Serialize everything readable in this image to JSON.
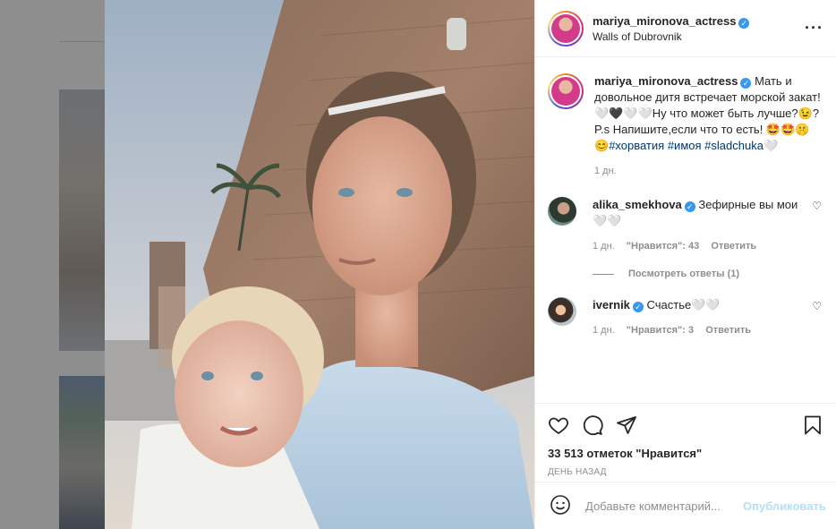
{
  "post": {
    "username": "mariya_mironova_actress",
    "location": "Walls of Dubrovnik",
    "more_icon": "more-horizontal-icon"
  },
  "caption": {
    "username": "mariya_mironova_actress",
    "text": "Мать и довольное дитя встречает морской закат! 🤍🖤🤍🤍Ну что может быть лучше?😉? P.s Напишите,если что то есть! 🤩🤩🤫😊",
    "hashtags": [
      "#хорватия",
      "#имоя",
      "#sladchuka"
    ],
    "hashtag_trail": "🤍",
    "time": "1 дн."
  },
  "comments": [
    {
      "username": "alika_smekhova",
      "text": "Зефирные вы мои🤍🤍",
      "time": "1 дн.",
      "likes_label": "\"Нравится\": 43",
      "reply_label": "Ответить"
    },
    {
      "username": "ivernik",
      "text": "Счастье🤍🤍",
      "time": "1 дн.",
      "likes_label": "\"Нравится\": 3",
      "reply_label": "Ответить"
    }
  ],
  "view_replies": "Посмотреть ответы (1)",
  "actions": {
    "likes": "33 513 отметок \"Нравится\"",
    "date": "ДЕНЬ НАЗАД"
  },
  "add_comment": {
    "placeholder": "Добавьте комментарий...",
    "post_label": "Опубликовать"
  },
  "colors": {
    "link": "#00376b",
    "verified": "#3897f0",
    "post_button_disabled": "#b2dffc",
    "muted": "#8e8e8e"
  }
}
